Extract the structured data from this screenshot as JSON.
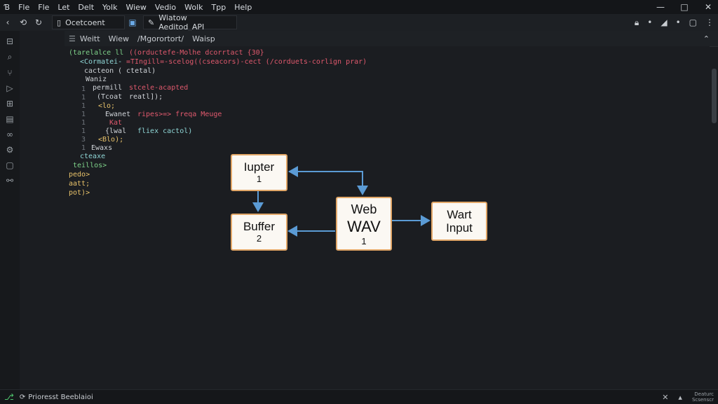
{
  "menubar": {
    "app_icon": "Ɓ",
    "items": [
      "Fle",
      "Fle",
      "Let",
      "Delt",
      "Yolk",
      "Wiew",
      "Vedio",
      "Wolk",
      "Tpp",
      "Help"
    ]
  },
  "toolbar": {
    "tab_label": "Ocetcoent",
    "title": "Wiatow Aeditod_API"
  },
  "tabs": [
    "Weitt",
    "Wiew",
    "/Mgorortort/",
    "Waisp"
  ],
  "code": {
    "line_numbers": [
      "1",
      "1",
      "1",
      "1",
      "1",
      "1",
      "3",
      "1"
    ],
    "lines": [
      {
        "text": "(tarelalce ll",
        "color": "#7fd38a"
      },
      {
        "text": "<Cormatei-",
        "color": "#8fd6d6"
      },
      {
        "text": "cacteon",
        "color": "#ccd0d4"
      },
      {
        "text": "Waniz",
        "color": "#ccd0d4"
      },
      {
        "text": "permill",
        "color": "#cfd3d8"
      },
      {
        "text": "(Tcoat",
        "color": "#cfd3d8"
      },
      {
        "text": "<lo;",
        "color": "#e8c26a"
      },
      {
        "text": "Ewanet",
        "color": "#cfd3d8"
      },
      {
        "text": "Kat",
        "color": "#e0596d"
      },
      {
        "text": "{lwal",
        "color": "#cfd3d8"
      },
      {
        "text": "<Blo);",
        "color": "#e8c26a"
      },
      {
        "text": "Ewaxs",
        "color": "#cfd3d8"
      },
      {
        "text": "cteaxe",
        "color": "#8fd6d6"
      },
      {
        "text": "teillos>",
        "color": "#7fd38a"
      },
      {
        "text": "pedo>",
        "color": "#e8c26a"
      },
      {
        "text": "aatt;",
        "color": "#e8c26a"
      },
      {
        "text": "pot)>",
        "color": "#e8c26a"
      }
    ],
    "extra": [
      {
        "text": "((orductefe-Molhe dcorrtact {30}",
        "color": "#e0596d"
      },
      {
        "text": "=TIngill=-scelog((cseacors)-cect (/corduets-corlign prar)",
        "color": "#e0596d"
      },
      {
        "text": "( ctetal)",
        "color": "#cfd3d8"
      },
      {
        "text": "stcele-acapted",
        "color": "#e0596d"
      },
      {
        "text": "reatl]);",
        "color": "#cfd3d8"
      },
      {
        "text": "ripes>=> freqa Meuge",
        "color": "#e0596d"
      },
      {
        "text": "fliex cactol)",
        "color": "#8fd6d6"
      }
    ]
  },
  "diagram": {
    "nodes": {
      "butter1": {
        "title": "Iupter",
        "num": "1"
      },
      "buffer2": {
        "title": "Buffer",
        "num": "2"
      },
      "web": {
        "title": "Web",
        "sub": "WAV",
        "num": "1"
      },
      "wart": {
        "title": "Wart",
        "sub": "Input"
      }
    }
  },
  "status": {
    "left_text": "Prioresst Beeblaioi",
    "right_small_1": "Deaturc",
    "right_small_2": "Scsenscr"
  },
  "colors": {
    "accent_border": "#e2a768",
    "arrow": "#5b9bd5"
  }
}
